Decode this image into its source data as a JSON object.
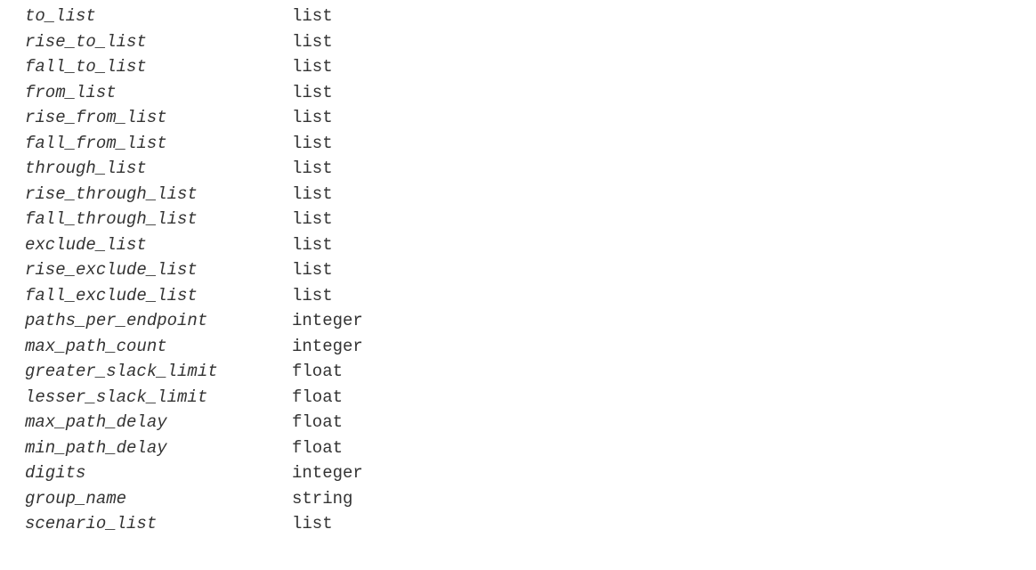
{
  "rows": [
    {
      "param": "to_list",
      "type": "list"
    },
    {
      "param": "rise_to_list",
      "type": "list"
    },
    {
      "param": "fall_to_list",
      "type": "list"
    },
    {
      "param": "from_list",
      "type": "list"
    },
    {
      "param": "rise_from_list",
      "type": "list"
    },
    {
      "param": "fall_from_list",
      "type": "list"
    },
    {
      "param": "through_list",
      "type": "list"
    },
    {
      "param": "rise_through_list",
      "type": "list"
    },
    {
      "param": "fall_through_list",
      "type": "list"
    },
    {
      "param": "exclude_list",
      "type": "list"
    },
    {
      "param": "rise_exclude_list",
      "type": "list"
    },
    {
      "param": "fall_exclude_list",
      "type": "list"
    },
    {
      "param": "paths_per_endpoint",
      "type": "integer"
    },
    {
      "param": "max_path_count",
      "type": "integer"
    },
    {
      "param": "greater_slack_limit",
      "type": "float"
    },
    {
      "param": "lesser_slack_limit",
      "type": "float"
    },
    {
      "param": "max_path_delay",
      "type": "float"
    },
    {
      "param": "min_path_delay",
      "type": "float"
    },
    {
      "param": "digits",
      "type": "integer"
    },
    {
      "param": "group_name",
      "type": "string"
    },
    {
      "param": "scenario_list",
      "type": "list"
    }
  ]
}
